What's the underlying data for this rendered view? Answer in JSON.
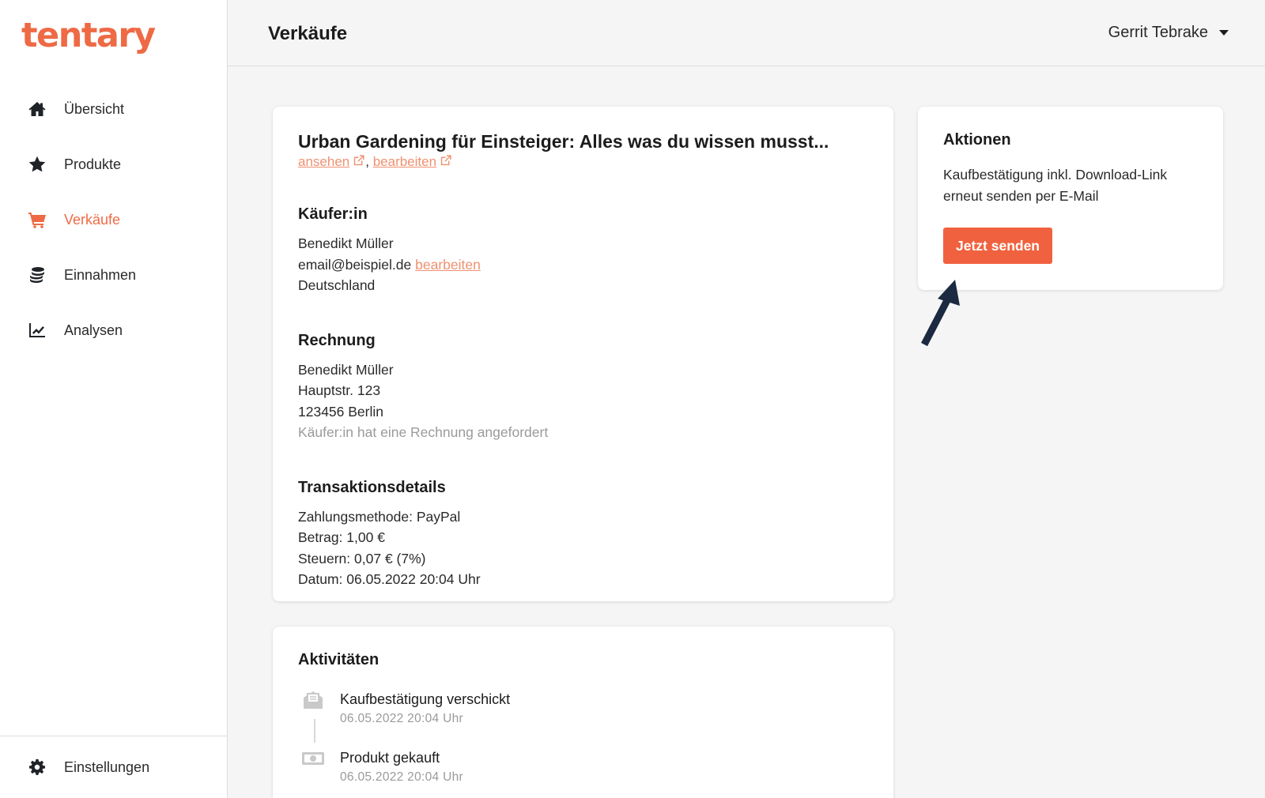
{
  "brand": {
    "logo": "tentary",
    "accent": "#ee6a45",
    "button_color": "#f0623f"
  },
  "sidebar": {
    "items": [
      {
        "label": "Übersicht",
        "icon": "home-icon"
      },
      {
        "label": "Produkte",
        "icon": "star-icon"
      },
      {
        "label": "Verkäufe",
        "icon": "cart-icon",
        "active": true
      },
      {
        "label": "Einnahmen",
        "icon": "coins-icon"
      },
      {
        "label": "Analysen",
        "icon": "chart-line-icon"
      }
    ],
    "settings": {
      "label": "Einstellungen",
      "icon": "gear-icon"
    }
  },
  "header": {
    "title": "Verkäufe",
    "user_name": "Gerrit Tebrake"
  },
  "sale": {
    "product_title": "Urban Gardening für Einsteiger: Alles was du wissen musst...",
    "view_link": "ansehen",
    "edit_link": "bearbeiten",
    "link_separator": ",",
    "buyer": {
      "heading": "Käufer:in",
      "name": "Benedikt Müller",
      "email": "email@beispiel.de",
      "email_edit": "bearbeiten",
      "country": "Deutschland"
    },
    "invoice": {
      "heading": "Rechnung",
      "name": "Benedikt Müller",
      "street": "Hauptstr. 123",
      "city": "123456 Berlin",
      "note": "Käufer:in hat eine Rechnung angefordert"
    },
    "transaction": {
      "heading": "Transaktionsdetails",
      "payment_method": "Zahlungsmethode: PayPal",
      "amount": "Betrag: 1,00 €",
      "tax": "Steuern: 0,07 € (7%)",
      "date": "Datum: 06.05.2022 20:04 Uhr"
    }
  },
  "actions": {
    "heading": "Aktionen",
    "text_line1": "Kaufbestätigung inkl. Download-Link",
    "text_line2": "erneut senden per E-Mail",
    "button": "Jetzt senden"
  },
  "activity": {
    "heading": "Aktivitäten",
    "items": [
      {
        "label": "Kaufbestätigung verschickt",
        "date": "06.05.2022 20:04 Uhr",
        "icon": "mail-open-icon"
      },
      {
        "label": "Produkt gekauft",
        "date": "06.05.2022 20:04 Uhr",
        "icon": "money-bill-icon"
      }
    ]
  }
}
